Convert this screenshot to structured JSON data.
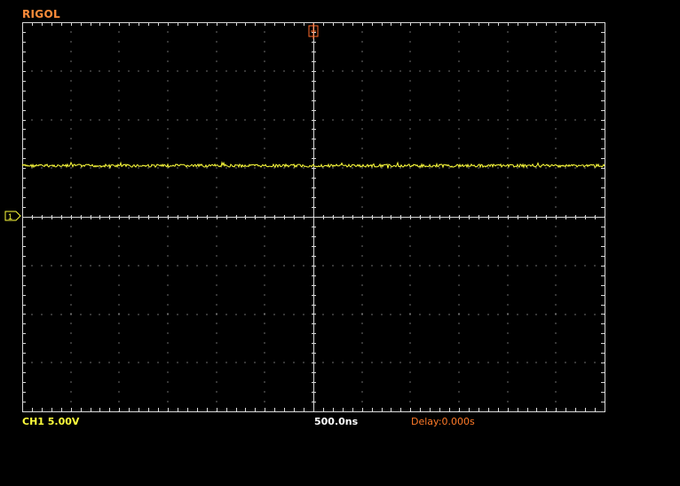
{
  "brand": "RIGOL",
  "readouts": {
    "channel": "CH1  5.00V",
    "timebase": "500.0ns",
    "delay": "Delay:0.000s"
  },
  "ground_marker": "1",
  "colors": {
    "background": "#000000",
    "brand": "#ff8c3a",
    "grid": "#d8d8d8",
    "trace": "#ffff3c",
    "channel_text": "#ffff3c",
    "timebase_text": "#ffffff",
    "delay_text": "#ff7a28",
    "trigger_marker": "#ff6a2a"
  },
  "chart_data": {
    "type": "line",
    "grid": true,
    "divisions": {
      "horizontal": 12,
      "vertical": 8
    },
    "series": [
      {
        "level_div": 1.05,
        "noise_div": 0.03
      }
    ]
  }
}
